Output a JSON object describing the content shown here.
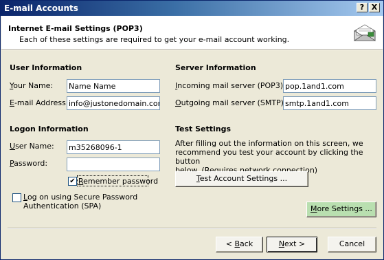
{
  "window": {
    "title": "E-mail Accounts",
    "help_button": "?",
    "close_button": "X"
  },
  "header": {
    "title": "Internet E-mail Settings (POP3)",
    "description": "Each of these settings are required to get your e-mail account working.",
    "icon": "mail-envelope-icon"
  },
  "user_info": {
    "title": "User Information",
    "name_label_u": "Y",
    "name_label_rest": "our Name:",
    "name_value": "Name Name",
    "email_label_u": "E",
    "email_label_rest": "-mail Address:",
    "email_value": "info@justonedomain.com"
  },
  "logon_info": {
    "title": "Logon Information",
    "username_label_u": "U",
    "username_label_rest": "ser Name:",
    "username_value": "m35268096-1",
    "password_label_u": "P",
    "password_label_rest": "assword:",
    "password_value": "",
    "remember_label_u": "R",
    "remember_label_rest": "emember password",
    "remember_checked": "✔",
    "spa_label_line1_pre": "",
    "spa_label_u": "L",
    "spa_label_line1_rest": "og on using Secure Password",
    "spa_label_line2": "Authentication (SPA)"
  },
  "server_info": {
    "title": "Server Information",
    "incoming_label_u": "I",
    "incoming_label_rest": "ncoming mail server (POP3):",
    "incoming_value": "pop.1and1.com",
    "outgoing_label_u": "O",
    "outgoing_label_rest": "utgoing mail server (SMTP):",
    "outgoing_value": "smtp.1and1.com"
  },
  "test_settings": {
    "title": "Test Settings",
    "line1": "After filling out the information on this screen, we",
    "line2": "recommend you test your account by clicking the button",
    "line3": "below. (Requires network connection)",
    "button_u": "T",
    "button_rest": "est Account Settings ..."
  },
  "buttons": {
    "more_settings_u": "M",
    "more_settings_rest": "ore Settings ...",
    "back_pre": "< ",
    "back_u": "B",
    "back_rest": "ack",
    "next_u": "N",
    "next_rest": "ext >",
    "cancel": "Cancel"
  }
}
